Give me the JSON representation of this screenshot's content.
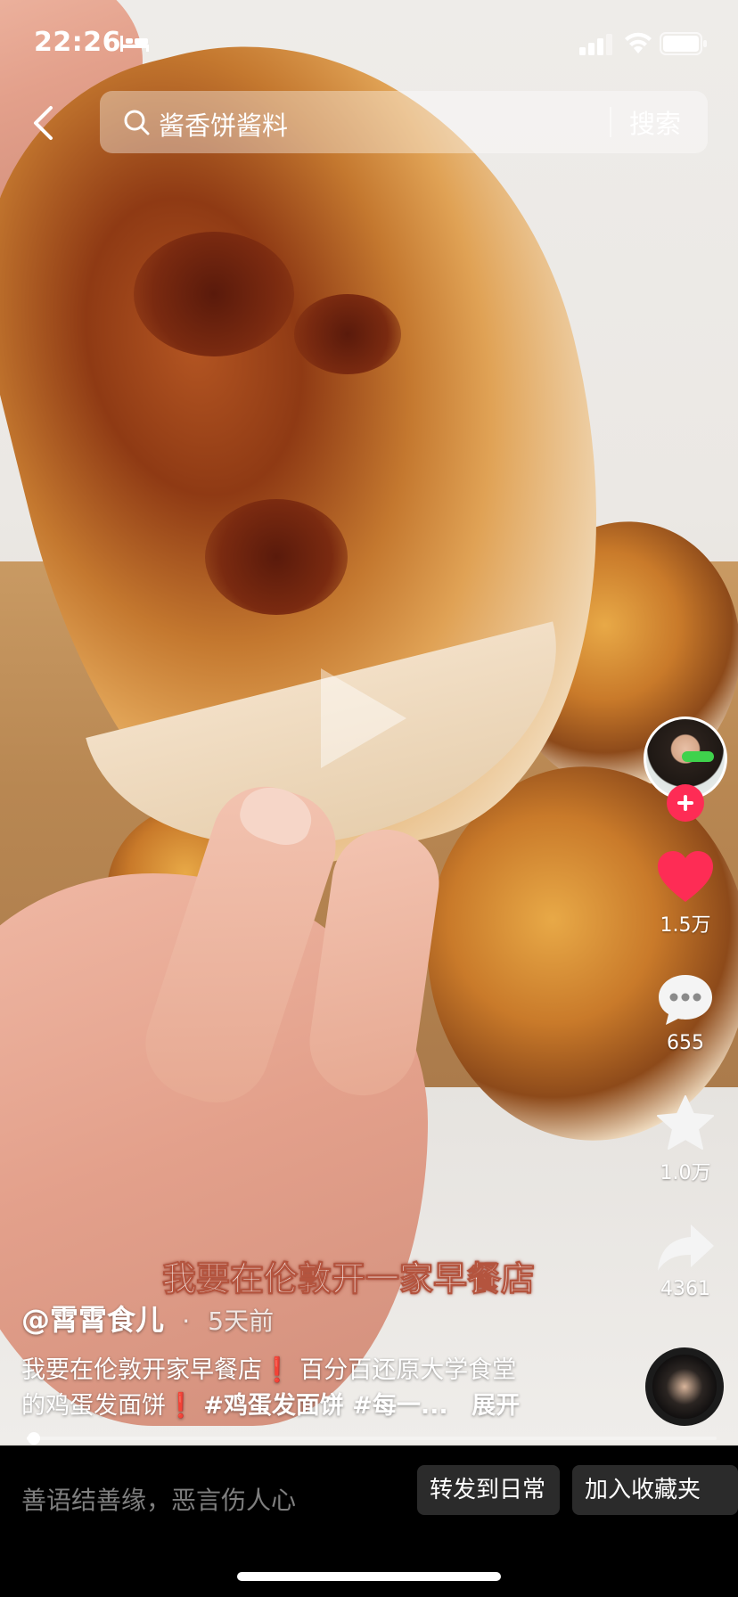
{
  "status_bar": {
    "time": "22:26"
  },
  "search": {
    "query": "酱香饼酱料",
    "button_label": "搜索"
  },
  "video": {
    "caption_overlay": "我要在伦敦开一家早餐店",
    "progress": 0.01
  },
  "author": {
    "handle": "@霄霄食儿",
    "separator": "·",
    "time_ago": "5天前"
  },
  "description": {
    "line1_a": "我要在伦敦开家早餐店",
    "line1_b": "百分百还原大学食堂",
    "line2_a": "的鸡蛋发面饼",
    "line2_tags": "#鸡蛋发面饼 #每一...",
    "expand": "展开",
    "exclamation": "❗"
  },
  "actions": {
    "like_count": "1.5万",
    "comment_count": "655",
    "favorite_count": "1.0万",
    "share_count": "4361",
    "like_color": "#fe2c55",
    "follow_color": "#fe2c55"
  },
  "bottom_bar": {
    "comment_placeholder": "善语结善缘，恶言伤人心",
    "repost_label": "转发到日常",
    "collect_label": "加入收藏夹"
  }
}
